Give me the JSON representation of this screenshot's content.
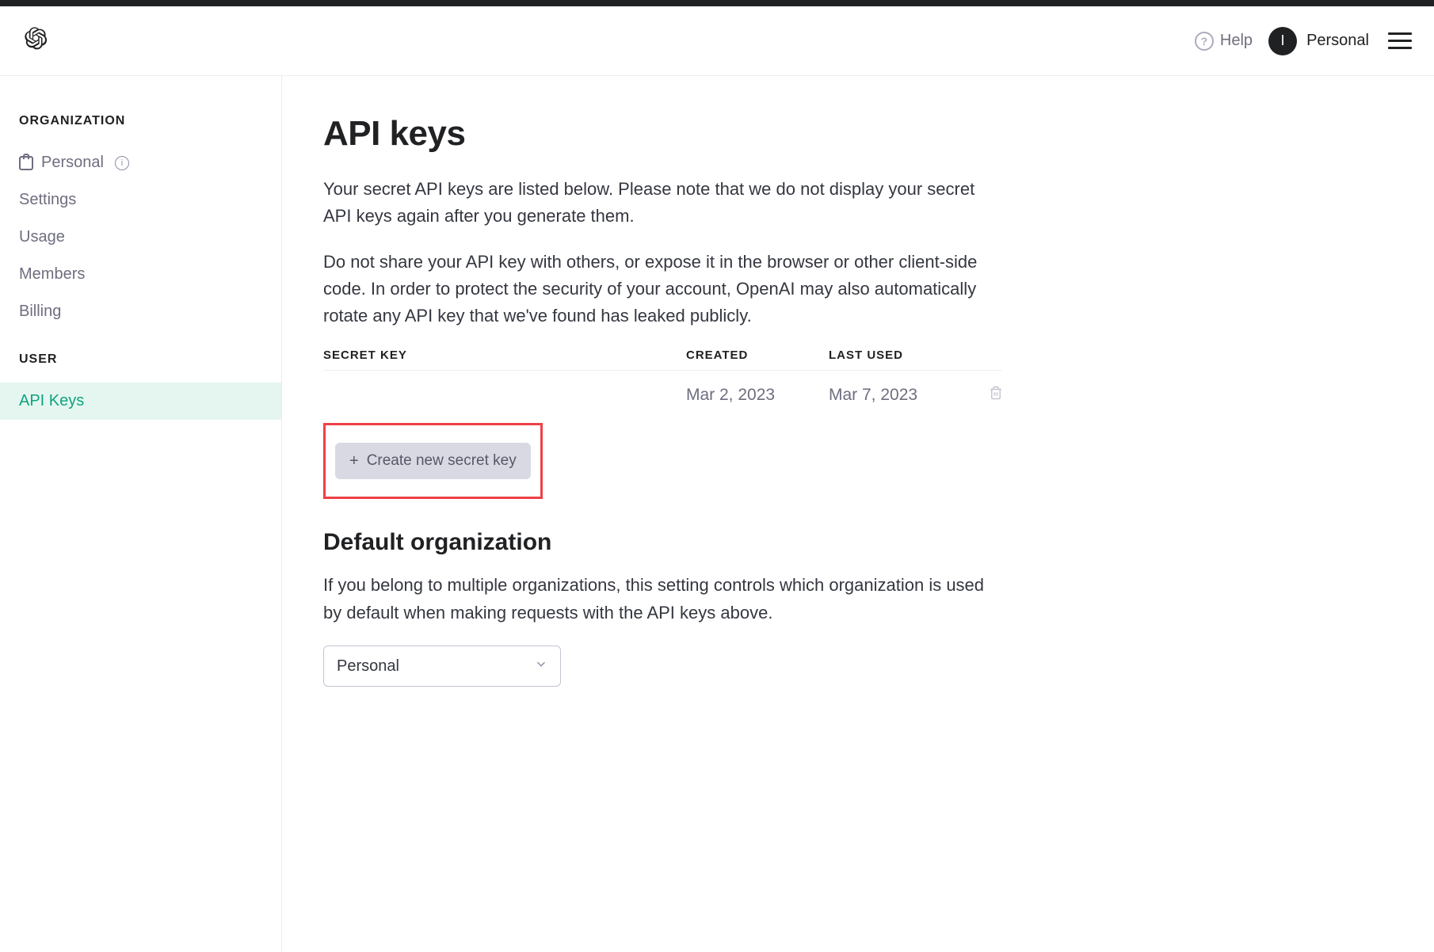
{
  "header": {
    "help_label": "Help",
    "user_initial": "I",
    "user_name": "Personal"
  },
  "sidebar": {
    "org_section_title": "ORGANIZATION",
    "org_name": "Personal",
    "items": [
      {
        "label": "Settings"
      },
      {
        "label": "Usage"
      },
      {
        "label": "Members"
      },
      {
        "label": "Billing"
      }
    ],
    "user_section_title": "USER",
    "user_items": [
      {
        "label": "API Keys",
        "active": true
      }
    ]
  },
  "main": {
    "page_title": "API keys",
    "intro_p1": "Your secret API keys are listed below. Please note that we do not display your secret API keys again after you generate them.",
    "intro_p2": "Do not share your API key with others, or expose it in the browser or other client-side code. In order to protect the security of your account, OpenAI may also automatically rotate any API key that we've found has leaked publicly.",
    "table": {
      "headers": {
        "secret": "SECRET KEY",
        "created": "CREATED",
        "last_used": "LAST USED"
      },
      "rows": [
        {
          "secret": "",
          "created": "Mar 2, 2023",
          "last_used": "Mar 7, 2023"
        }
      ]
    },
    "create_button_label": "Create new secret key",
    "default_org": {
      "title": "Default organization",
      "description": "If you belong to multiple organizations, this setting controls which organization is used by default when making requests with the API keys above.",
      "selected": "Personal"
    }
  }
}
